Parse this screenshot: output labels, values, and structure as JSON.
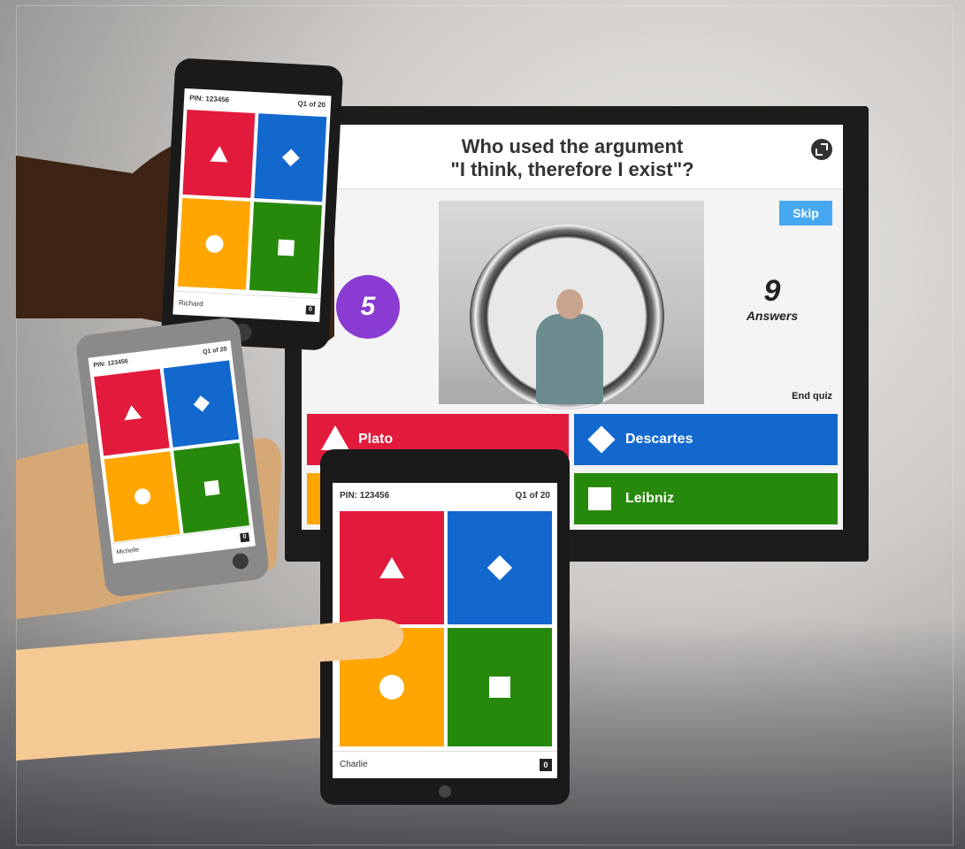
{
  "colors": {
    "red": "#e21b3c",
    "blue": "#1368ce",
    "yellow": "#ffa602",
    "green": "#26890c",
    "purple": "#8a3bd1",
    "skip": "#46a8f0"
  },
  "tv": {
    "question_line1": "Who used the argument",
    "question_line2": "\"I think, therefore I exist\"?",
    "fullscreen_icon": "fullscreen-icon",
    "timer": "5",
    "skip_label": "Skip",
    "answers_count": "9",
    "answers_label": "Answers",
    "end_quiz_label": "End quiz",
    "answers": [
      {
        "label": "Plato",
        "shape": "triangle",
        "color": "red"
      },
      {
        "label": "Descartes",
        "shape": "diamond",
        "color": "blue"
      },
      {
        "label": "",
        "shape": "circle",
        "color": "yellow"
      },
      {
        "label": "Leibniz",
        "shape": "square",
        "color": "green"
      }
    ]
  },
  "phone_top": {
    "pin": "PIN: 123456",
    "question_progress": "Q1 of 20",
    "player": "Richard",
    "score": "0"
  },
  "phone_mid": {
    "pin": "PIN: 123456",
    "question_progress": "Q1 of 20",
    "player": "Michelle",
    "score": "0"
  },
  "tablet": {
    "pin": "PIN: 123456",
    "question_progress": "Q1 of 20",
    "player": "Charlie",
    "score": "0"
  }
}
